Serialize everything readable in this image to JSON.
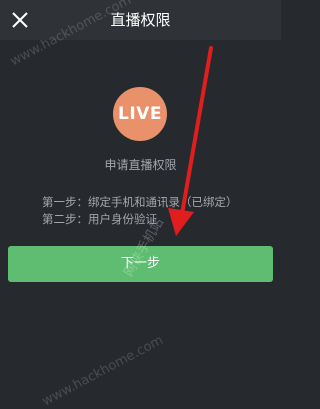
{
  "header": {
    "title": "直播权限",
    "close_icon": "close-icon"
  },
  "live_badge": {
    "label": "LIVE",
    "color": "#e9916a"
  },
  "content": {
    "apply_title": "申请直播权限",
    "steps": [
      "第一步：绑定手机和通讯录（已绑定）",
      "第二步：用户身份验证"
    ]
  },
  "next_button": {
    "label": "下一步",
    "color": "#5fbd72"
  },
  "watermarks": {
    "top": "www.hackhome.com",
    "middle": "网侠手机站",
    "bottom": "www.hackhome.com"
  },
  "annotation": {
    "arrow_color": "#e01e1e",
    "arrow_icon": "red-arrow-icon"
  }
}
